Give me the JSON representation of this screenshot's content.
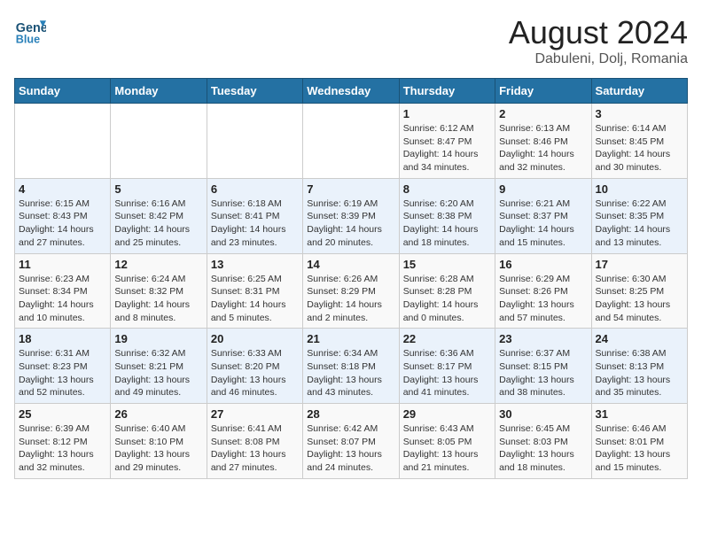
{
  "header": {
    "logo_line1": "General",
    "logo_line2": "Blue",
    "main_title": "August 2024",
    "sub_title": "Dabuleni, Dolj, Romania"
  },
  "days_of_week": [
    "Sunday",
    "Monday",
    "Tuesday",
    "Wednesday",
    "Thursday",
    "Friday",
    "Saturday"
  ],
  "weeks": [
    [
      {
        "day": "",
        "detail": ""
      },
      {
        "day": "",
        "detail": ""
      },
      {
        "day": "",
        "detail": ""
      },
      {
        "day": "",
        "detail": ""
      },
      {
        "day": "1",
        "detail": "Sunrise: 6:12 AM\nSunset: 8:47 PM\nDaylight: 14 hours and 34 minutes."
      },
      {
        "day": "2",
        "detail": "Sunrise: 6:13 AM\nSunset: 8:46 PM\nDaylight: 14 hours and 32 minutes."
      },
      {
        "day": "3",
        "detail": "Sunrise: 6:14 AM\nSunset: 8:45 PM\nDaylight: 14 hours and 30 minutes."
      }
    ],
    [
      {
        "day": "4",
        "detail": "Sunrise: 6:15 AM\nSunset: 8:43 PM\nDaylight: 14 hours and 27 minutes."
      },
      {
        "day": "5",
        "detail": "Sunrise: 6:16 AM\nSunset: 8:42 PM\nDaylight: 14 hours and 25 minutes."
      },
      {
        "day": "6",
        "detail": "Sunrise: 6:18 AM\nSunset: 8:41 PM\nDaylight: 14 hours and 23 minutes."
      },
      {
        "day": "7",
        "detail": "Sunrise: 6:19 AM\nSunset: 8:39 PM\nDaylight: 14 hours and 20 minutes."
      },
      {
        "day": "8",
        "detail": "Sunrise: 6:20 AM\nSunset: 8:38 PM\nDaylight: 14 hours and 18 minutes."
      },
      {
        "day": "9",
        "detail": "Sunrise: 6:21 AM\nSunset: 8:37 PM\nDaylight: 14 hours and 15 minutes."
      },
      {
        "day": "10",
        "detail": "Sunrise: 6:22 AM\nSunset: 8:35 PM\nDaylight: 14 hours and 13 minutes."
      }
    ],
    [
      {
        "day": "11",
        "detail": "Sunrise: 6:23 AM\nSunset: 8:34 PM\nDaylight: 14 hours and 10 minutes."
      },
      {
        "day": "12",
        "detail": "Sunrise: 6:24 AM\nSunset: 8:32 PM\nDaylight: 14 hours and 8 minutes."
      },
      {
        "day": "13",
        "detail": "Sunrise: 6:25 AM\nSunset: 8:31 PM\nDaylight: 14 hours and 5 minutes."
      },
      {
        "day": "14",
        "detail": "Sunrise: 6:26 AM\nSunset: 8:29 PM\nDaylight: 14 hours and 2 minutes."
      },
      {
        "day": "15",
        "detail": "Sunrise: 6:28 AM\nSunset: 8:28 PM\nDaylight: 14 hours and 0 minutes."
      },
      {
        "day": "16",
        "detail": "Sunrise: 6:29 AM\nSunset: 8:26 PM\nDaylight: 13 hours and 57 minutes."
      },
      {
        "day": "17",
        "detail": "Sunrise: 6:30 AM\nSunset: 8:25 PM\nDaylight: 13 hours and 54 minutes."
      }
    ],
    [
      {
        "day": "18",
        "detail": "Sunrise: 6:31 AM\nSunset: 8:23 PM\nDaylight: 13 hours and 52 minutes."
      },
      {
        "day": "19",
        "detail": "Sunrise: 6:32 AM\nSunset: 8:21 PM\nDaylight: 13 hours and 49 minutes."
      },
      {
        "day": "20",
        "detail": "Sunrise: 6:33 AM\nSunset: 8:20 PM\nDaylight: 13 hours and 46 minutes."
      },
      {
        "day": "21",
        "detail": "Sunrise: 6:34 AM\nSunset: 8:18 PM\nDaylight: 13 hours and 43 minutes."
      },
      {
        "day": "22",
        "detail": "Sunrise: 6:36 AM\nSunset: 8:17 PM\nDaylight: 13 hours and 41 minutes."
      },
      {
        "day": "23",
        "detail": "Sunrise: 6:37 AM\nSunset: 8:15 PM\nDaylight: 13 hours and 38 minutes."
      },
      {
        "day": "24",
        "detail": "Sunrise: 6:38 AM\nSunset: 8:13 PM\nDaylight: 13 hours and 35 minutes."
      }
    ],
    [
      {
        "day": "25",
        "detail": "Sunrise: 6:39 AM\nSunset: 8:12 PM\nDaylight: 13 hours and 32 minutes."
      },
      {
        "day": "26",
        "detail": "Sunrise: 6:40 AM\nSunset: 8:10 PM\nDaylight: 13 hours and 29 minutes."
      },
      {
        "day": "27",
        "detail": "Sunrise: 6:41 AM\nSunset: 8:08 PM\nDaylight: 13 hours and 27 minutes."
      },
      {
        "day": "28",
        "detail": "Sunrise: 6:42 AM\nSunset: 8:07 PM\nDaylight: 13 hours and 24 minutes."
      },
      {
        "day": "29",
        "detail": "Sunrise: 6:43 AM\nSunset: 8:05 PM\nDaylight: 13 hours and 21 minutes."
      },
      {
        "day": "30",
        "detail": "Sunrise: 6:45 AM\nSunset: 8:03 PM\nDaylight: 13 hours and 18 minutes."
      },
      {
        "day": "31",
        "detail": "Sunrise: 6:46 AM\nSunset: 8:01 PM\nDaylight: 13 hours and 15 minutes."
      }
    ]
  ]
}
